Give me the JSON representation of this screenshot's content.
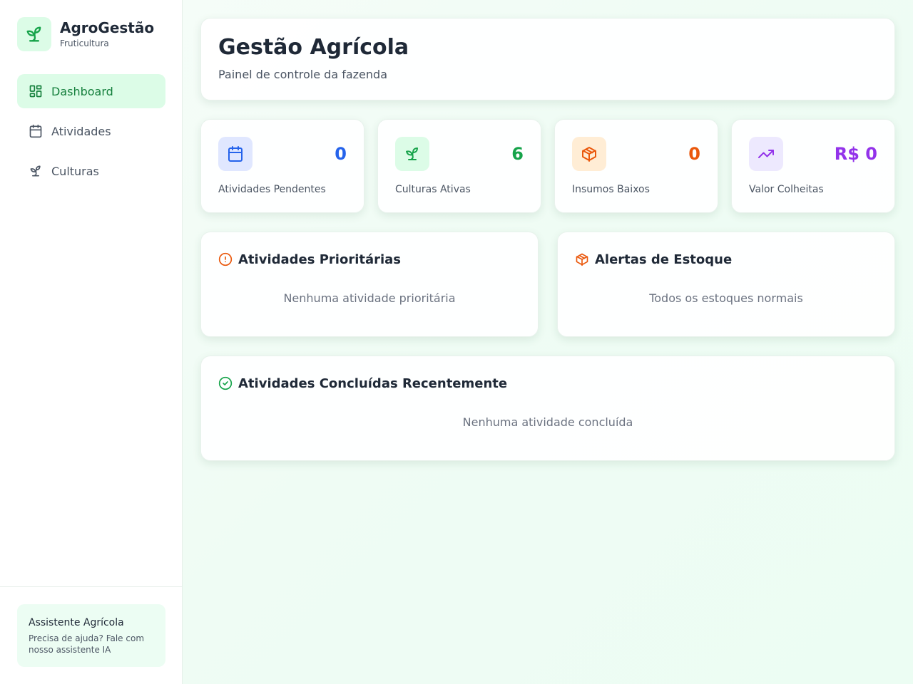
{
  "brand": {
    "title": "AgroGestão",
    "subtitle": "Fruticultura"
  },
  "nav": [
    {
      "label": "Dashboard",
      "icon": "dashboard-icon",
      "active": true
    },
    {
      "label": "Atividades",
      "icon": "calendar-icon",
      "active": false
    },
    {
      "label": "Culturas",
      "icon": "sprout-icon",
      "active": false
    }
  ],
  "assistant": {
    "title": "Assistente Agrícola",
    "text": "Precisa de ajuda? Fale com nosso assistente IA"
  },
  "header": {
    "title": "Gestão Agrícola",
    "subtitle": "Painel de controle da fazenda"
  },
  "stats": [
    {
      "value": "0",
      "label": "Atividades Pendentes",
      "icon": "calendar-icon",
      "color": "#2563eb",
      "bg": "#e0e7ff"
    },
    {
      "value": "6",
      "label": "Culturas Ativas",
      "icon": "sprout-icon",
      "color": "#16a34a",
      "bg": "#dcfce7"
    },
    {
      "value": "0",
      "label": "Insumos Baixos",
      "icon": "package-icon",
      "color": "#ea580c",
      "bg": "#ffedd5"
    },
    {
      "value": "R$ 0",
      "label": "Valor Colheitas",
      "icon": "trending-up-icon",
      "color": "#9333ea",
      "bg": "#ede9fe"
    }
  ],
  "panels": {
    "priority": {
      "title": "Atividades Prioritárias",
      "empty": "Nenhuma atividade prioritária",
      "icon": "alert-circle-icon"
    },
    "stock": {
      "title": "Alertas de Estoque",
      "empty": "Todos os estoques normais",
      "icon": "package-icon"
    },
    "completed": {
      "title": "Atividades Concluídas Recentemente",
      "empty": "Nenhuma atividade concluída",
      "icon": "check-circle-icon"
    }
  }
}
